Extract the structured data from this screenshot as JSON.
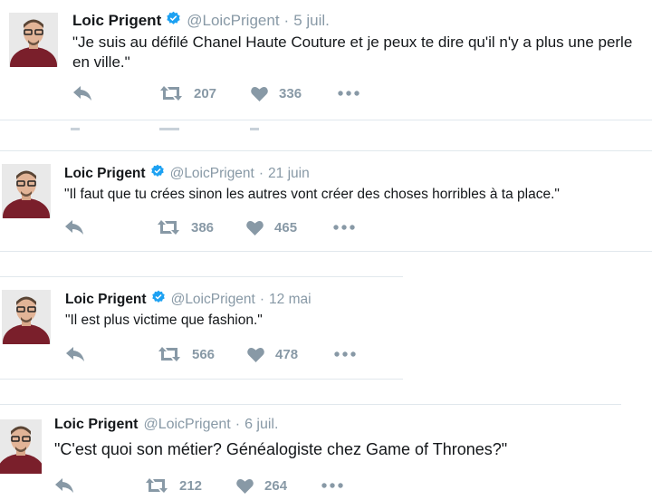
{
  "tweets": [
    {
      "name": "Loic Prigent",
      "handle": "@LoicPrigent",
      "date": "5 juil.",
      "verified": true,
      "text": "\"Je suis au défilé Chanel Haute Couture et je peux te dire qu'il n'y a plus une perle en ville.\"",
      "retweets": "207",
      "likes": "336"
    },
    {
      "name": "Loic Prigent",
      "handle": "@LoicPrigent",
      "date": "21 juin",
      "verified": true,
      "text": "\"Il faut que tu crées sinon les autres vont créer des choses horribles à ta place.\"",
      "retweets": "386",
      "likes": "465"
    },
    {
      "name": "Loic Prigent",
      "handle": "@LoicPrigent",
      "date": "12 mai",
      "verified": true,
      "text": "\"Il est plus victime que fashion.\"",
      "retweets": "566",
      "likes": "478"
    },
    {
      "name": "Loic Prigent",
      "handle": "@LoicPrigent",
      "date": "6 juil.",
      "verified": false,
      "text": "\"C'est quoi son métier? Généalogiste chez Game of Thrones?\"",
      "retweets": "212",
      "likes": "264"
    }
  ],
  "separator": "·",
  "icons": {
    "reply": "reply-icon",
    "retweet": "retweet-icon",
    "like": "heart-icon",
    "more": "more-icon",
    "verified": "verified-badge-icon"
  },
  "colors": {
    "text": "#14171a",
    "muted": "#8899a6",
    "verified": "#1da1f2",
    "divider": "#e1e8ed"
  }
}
